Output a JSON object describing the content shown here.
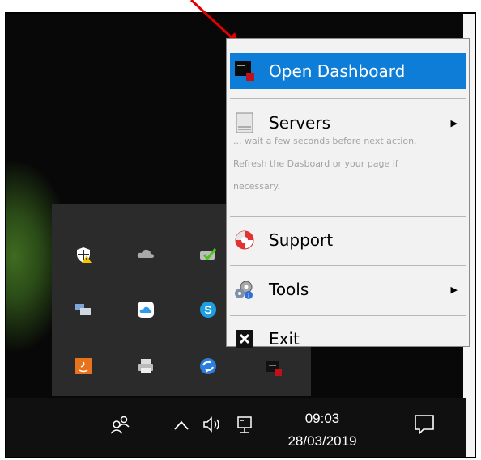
{
  "menu": {
    "items": [
      {
        "label": "Open Dashboard",
        "icon": "dashboard-icon",
        "highlighted": true
      },
      {
        "label": "Servers",
        "icon": "servers-icon",
        "has_submenu": true
      },
      {
        "label": "Support",
        "icon": "lifebuoy-icon"
      },
      {
        "label": "Tools",
        "icon": "tools-gear-icon",
        "has_submenu": true
      },
      {
        "label": "Exit",
        "icon": "exit-x-icon"
      }
    ],
    "note_lines": [
      "... wait a few seconds before next action.",
      "Refresh the Dasboard or your page if",
      "necessary."
    ],
    "submenu_glyph": "▶"
  },
  "taskbar": {
    "time": "09:03",
    "date": "28/03/2019",
    "people_glyph": "ዶ",
    "chevron_glyph": "^",
    "volume_glyph": "🔈",
    "network_glyph": "🖳"
  },
  "tray_icons": [
    "windows-security-warning-icon",
    "onedrive-cloud-icon",
    "sync-check-icon",
    "network-drive-icon",
    "icloud-icon",
    "skype-icon",
    "java-icon",
    "printer-icon",
    "sync-blue-icon",
    "dashboard-app-icon"
  ],
  "colors": {
    "highlight": "#0e7dd8",
    "arrow": "#e00000",
    "taskbar": "#101010",
    "tray": "#2b2b2b"
  }
}
